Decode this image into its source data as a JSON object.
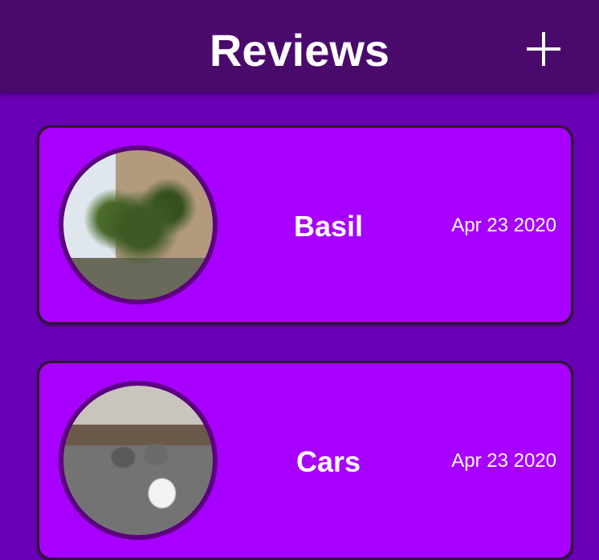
{
  "header": {
    "title": "Reviews"
  },
  "reviews": [
    {
      "name": "Basil",
      "date": "Apr 23 2020"
    },
    {
      "name": "Cars",
      "date": "Apr 23 2020"
    }
  ]
}
